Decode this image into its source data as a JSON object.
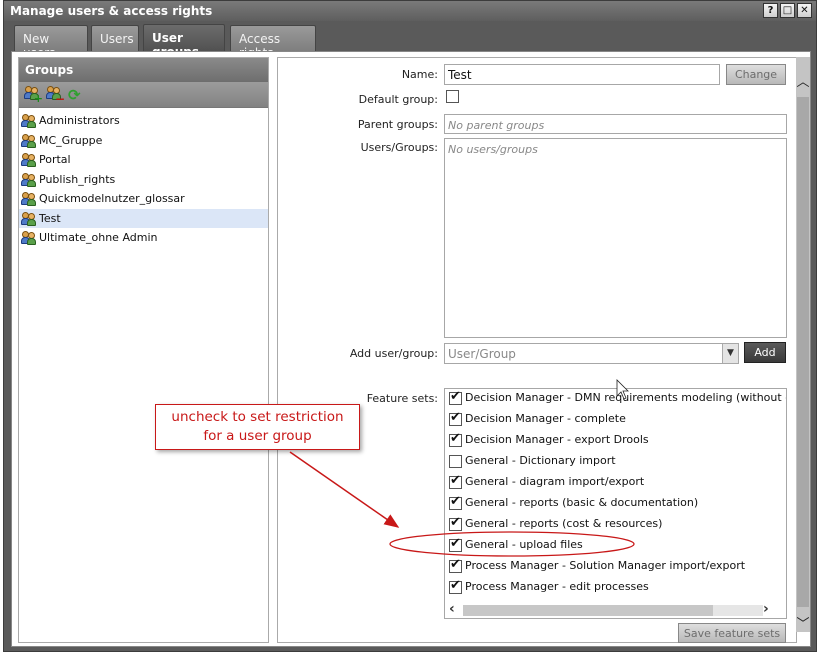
{
  "window": {
    "title": "Manage users & access rights",
    "controls": [
      "?",
      "□",
      "✕"
    ]
  },
  "tabs": [
    {
      "label": "New users",
      "active": false
    },
    {
      "label": "Users",
      "active": false
    },
    {
      "label": "User groups",
      "active": true
    },
    {
      "label": "Access rights",
      "active": false
    }
  ],
  "groups_panel": {
    "header": "Groups",
    "toolbar_icons": [
      "add-group-icon",
      "remove-group-icon",
      "refresh-icon"
    ],
    "items": [
      {
        "label": "Administrators",
        "selected": false
      },
      {
        "label": "MC_Gruppe",
        "selected": false
      },
      {
        "label": "Portal",
        "selected": false
      },
      {
        "label": "Publish_rights",
        "selected": false
      },
      {
        "label": "Quickmodelnutzer_glossar",
        "selected": false
      },
      {
        "label": "Test",
        "selected": true
      },
      {
        "label": "Ultimate_ohne Admin",
        "selected": false
      }
    ]
  },
  "detail": {
    "name_label": "Name:",
    "name_value": "Test",
    "change_button": "Change",
    "default_group_label": "Default group:",
    "default_group_checked": false,
    "parent_groups_label": "Parent groups:",
    "parent_groups_placeholder": "No parent groups",
    "users_groups_label": "Users/Groups:",
    "users_groups_placeholder": "No users/groups",
    "add_user_label": "Add user/group:",
    "add_user_placeholder": "User/Group",
    "add_button": "Add",
    "feature_sets_label": "Feature sets:",
    "feature_sets": [
      {
        "label": "Decision Manager - DMN requirements modeling (without deci",
        "checked": true
      },
      {
        "label": "Decision Manager - complete",
        "checked": true
      },
      {
        "label": "Decision Manager - export Drools",
        "checked": true
      },
      {
        "label": "General - Dictionary import",
        "checked": false
      },
      {
        "label": "General - diagram import/export",
        "checked": true
      },
      {
        "label": "General - reports (basic & documentation)",
        "checked": true
      },
      {
        "label": "General - reports (cost & resources)",
        "checked": true
      },
      {
        "label": "General - upload files",
        "checked": true
      },
      {
        "label": "Process Manager - Solution Manager import/export",
        "checked": true
      },
      {
        "label": "Process Manager - edit processes",
        "checked": true
      }
    ],
    "save_button": "Save feature sets"
  },
  "annotation": {
    "line1": "uncheck to set restriction",
    "line2": "for a user group",
    "color": "#c81818"
  }
}
